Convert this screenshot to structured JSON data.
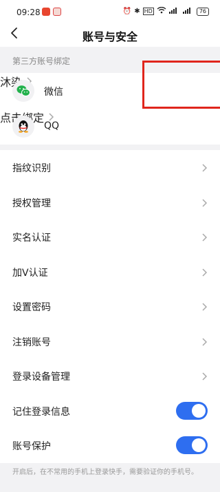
{
  "status_bar": {
    "time": "09:28",
    "icons": [
      "app-badge-red",
      "app-badge-small",
      "alarm-icon",
      "nfc-icon",
      "hd-icon",
      "wifi-icon",
      "signal-5g-icon",
      "signal-icon"
    ],
    "battery": "76"
  },
  "header": {
    "title": "账号与安全",
    "back_icon": "chevron-left-icon"
  },
  "third_party": {
    "section_label": "第三方账号绑定",
    "accounts": [
      {
        "name": "微信",
        "value": "沐染",
        "icon": "wechat-icon"
      },
      {
        "name": "QQ",
        "value": "点击绑定",
        "icon": "qq-icon"
      }
    ]
  },
  "settings": {
    "items": [
      {
        "label": "指纹识别"
      },
      {
        "label": "授权管理"
      },
      {
        "label": "实名认证"
      },
      {
        "label": "加V认证"
      },
      {
        "label": "设置密码"
      },
      {
        "label": "注销账号"
      },
      {
        "label": "登录设备管理"
      }
    ],
    "toggles": [
      {
        "label": "记住登录信息",
        "on": true
      },
      {
        "label": "账号保护",
        "on": true
      }
    ]
  },
  "footnote": "开启后，在不常用的手机上登录快手，需要验证你的手机号。",
  "colors": {
    "accent": "#2e6ef0",
    "annotation": "#e0251c",
    "muted": "#999999"
  }
}
